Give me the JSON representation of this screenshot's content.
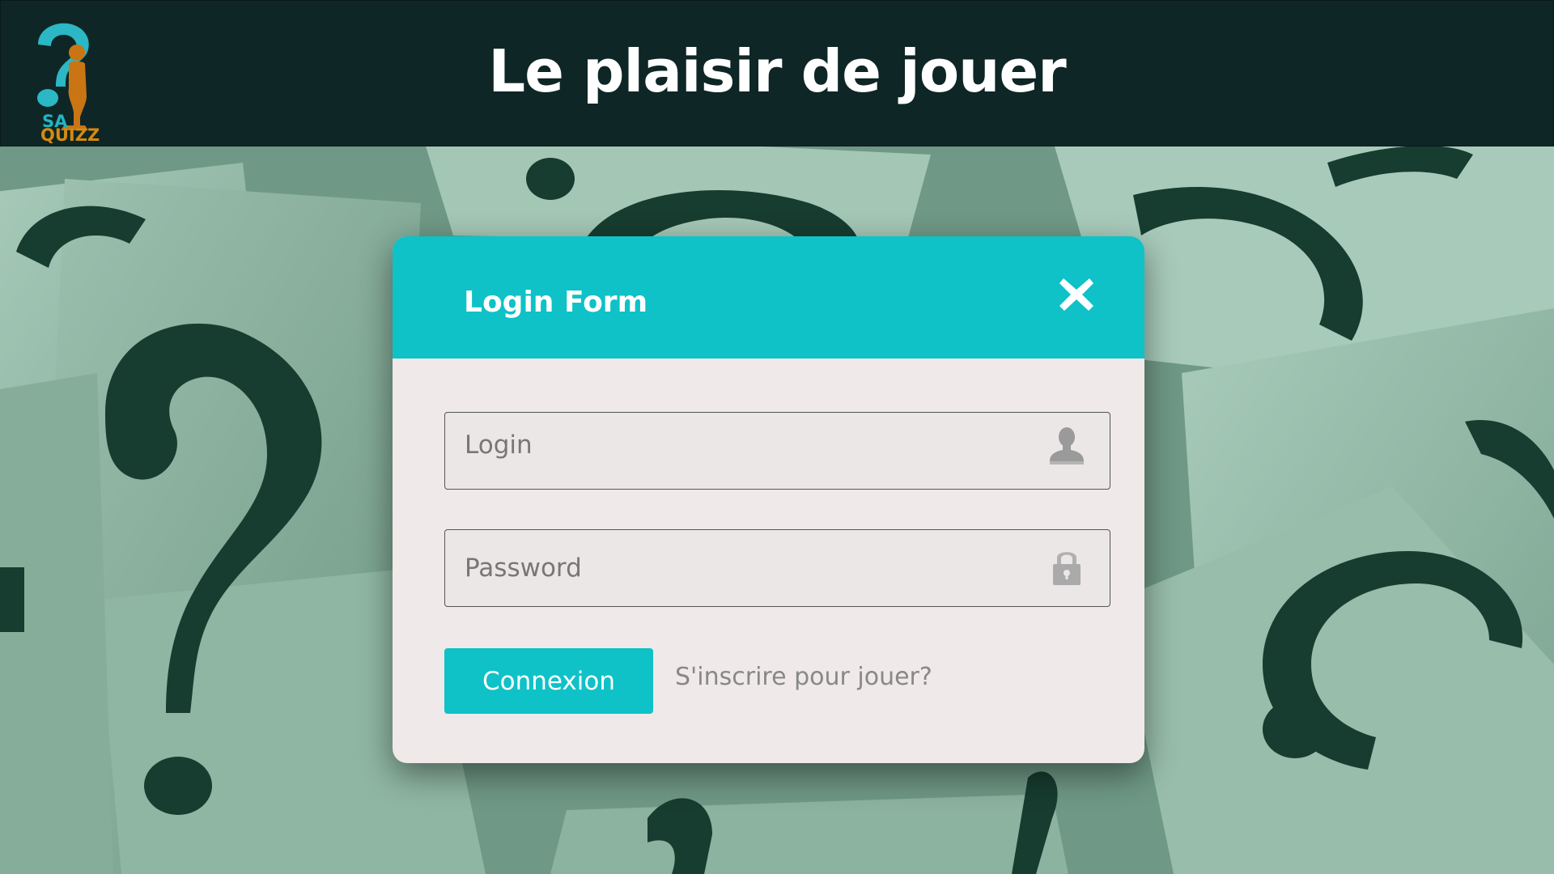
{
  "header": {
    "logo": {
      "top_text": "SA",
      "bottom_text": "QUIZZ",
      "icon": "question-mark-person-logo",
      "colors": {
        "question": "#2bb7c4",
        "person": "#c97514"
      }
    },
    "title": "Le plaisir de jouer",
    "background_color": "#0f2626"
  },
  "background": {
    "description_icon": "question-marks-background",
    "tint_color": "#7fa897"
  },
  "modal": {
    "title": "Login Form",
    "close_icon": "close-icon",
    "accent_color": "#0ec2c7",
    "body_color": "#efe9e9",
    "fields": {
      "login": {
        "placeholder": "Login",
        "value": "",
        "icon": "user-icon"
      },
      "password": {
        "placeholder": "Password",
        "value": "",
        "icon": "lock-icon"
      }
    },
    "submit_label": "Connexion",
    "register_link": "S'inscrire pour jouer?"
  }
}
